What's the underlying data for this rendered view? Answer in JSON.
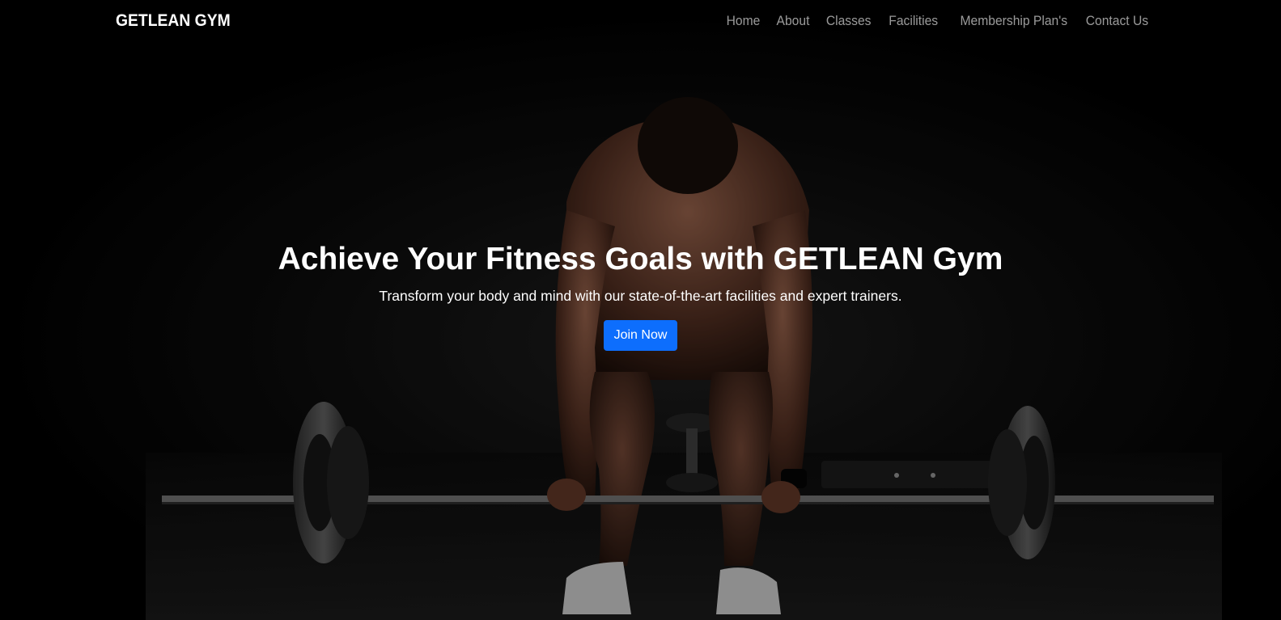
{
  "navbar": {
    "brand": "GETLEAN GYM",
    "links": [
      {
        "label": "Home"
      },
      {
        "label": "About"
      },
      {
        "label": "Classes"
      },
      {
        "label": "Facilities"
      },
      {
        "label": "Membership Plan's"
      },
      {
        "label": "Contact Us"
      }
    ]
  },
  "hero": {
    "title": "Achieve Your Fitness Goals with GETLEAN Gym",
    "subtitle": "Transform your body and mind with our state-of-the-art facilities and expert trainers.",
    "cta_label": "Join Now",
    "background_image": "weightlifter-deadlift-photo"
  },
  "colors": {
    "background": "#000000",
    "primary_button": "#0d6efd",
    "nav_link": "rgba(255,255,255,0.6)",
    "text": "#ffffff"
  }
}
